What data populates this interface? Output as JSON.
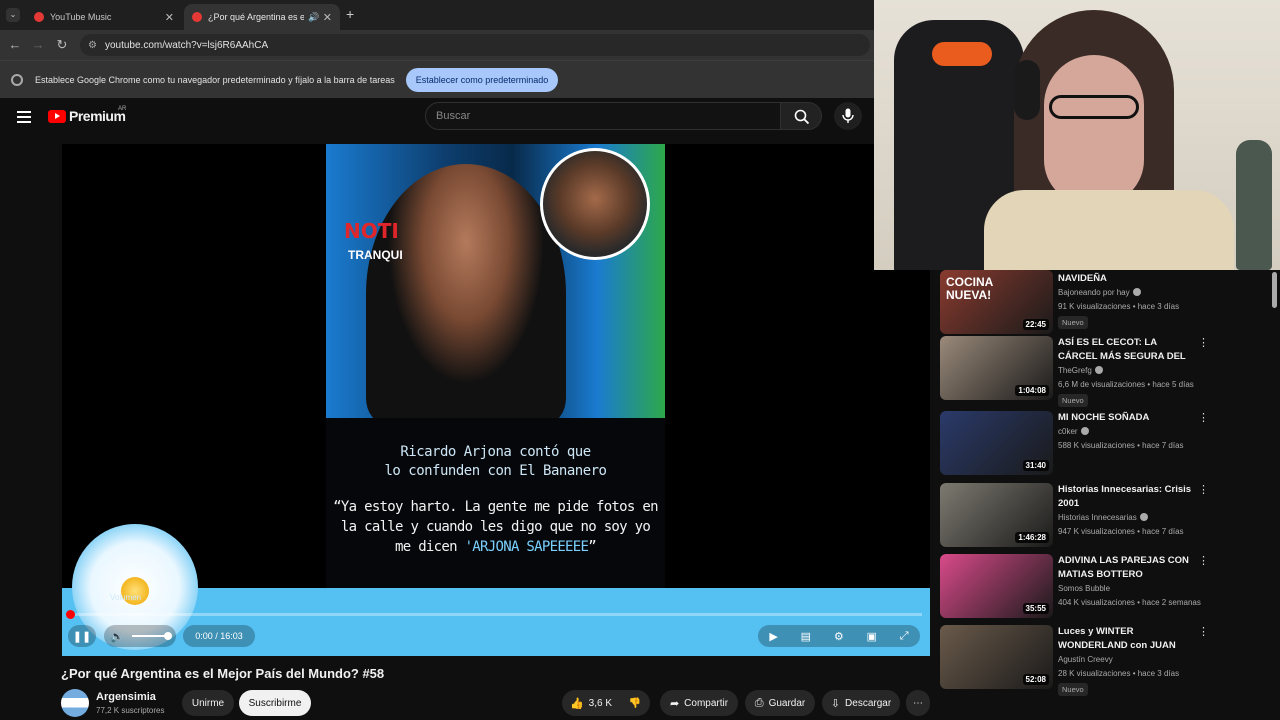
{
  "browser": {
    "tabs": [
      {
        "title": "YouTube Music",
        "active": false
      },
      {
        "title": "¿Por qué Argentina es el M",
        "active": true
      }
    ],
    "new_tab": "+",
    "url": "youtube.com/watch?v=lsj6R6AAhCA",
    "infobar": {
      "message": "Establece Google Chrome como tu navegador predeterminado y fíjalo a la barra de tareas",
      "button": "Establecer como predeterminado"
    }
  },
  "youtube": {
    "logo_text": "Premium",
    "country_code": "AR",
    "search_placeholder": "Buscar"
  },
  "video": {
    "overlay": {
      "show_name_1": "NOTI",
      "show_name_2": "TRANQUI",
      "caption_line1": "Ricardo Arjona contó que",
      "caption_line2": "lo confunden con El Bananero",
      "quote_line1": "“Ya estoy harto. La gente me pide fotos en",
      "quote_line2": "la calle y cuando les digo que no soy yo",
      "quote_line3_prefix": "me dicen ",
      "quote_line3_highlight": "'ARJONA SAPEEEEE",
      "quote_line3_suffix": "”"
    },
    "volume_tooltip": "Volumen",
    "time": "0:00 / 16:03",
    "progress": 0.0,
    "title": "¿Por qué Argentina es el Mejor País del Mundo? #58"
  },
  "channel": {
    "name": "Argensimia",
    "subscribers": "77,2 K suscriptores",
    "join": "Unirme",
    "subscribe": "Suscribirme"
  },
  "actions": {
    "likes": "3,6 K",
    "share": "Compartir",
    "save": "Guardar",
    "download": "Descargar"
  },
  "recommendations": [
    {
      "title": "NAVIDEÑA",
      "thumb_text": "COCINA NUEVA!",
      "channel": "Bajoneando por hay",
      "verified": true,
      "meta": "91 K visualizaciones • hace 3 días",
      "duration": "22:45",
      "badge": "Nuevo",
      "thumb_color": "#8a3b2f"
    },
    {
      "title": "ASÍ ES EL CECOT: LA CÁRCEL MÁS SEGURA DEL MUNDO",
      "channel": "TheGrefg",
      "verified": true,
      "meta": "6,6 M de visualizaciones • hace 5 días",
      "duration": "1:04:08",
      "badge": "Nuevo",
      "thumb_color": "#9a8a7a"
    },
    {
      "title": "MI NOCHE SOÑADA",
      "channel": "c0ker",
      "verified": true,
      "meta": "588 K visualizaciones • hace 7 días",
      "duration": "31:40",
      "badge": "",
      "thumb_color": "#2a3a6a"
    },
    {
      "title": "Historias Innecesarias: Crisis 2001",
      "channel": "Historias Innecesarias",
      "verified": true,
      "meta": "947 K visualizaciones • hace 7 días",
      "duration": "1:46:28",
      "badge": "",
      "thumb_color": "#7d7a70"
    },
    {
      "title": "ADIVINA LAS PAREJAS CON MATIAS BOTTERO",
      "channel": "Somos Bubble",
      "verified": false,
      "meta": "404 K visualizaciones • hace 2 semanas",
      "duration": "35:55",
      "badge": "",
      "thumb_color": "#d94a8a"
    },
    {
      "title": "Luces y WINTER WONDERLAND con JUAN GONZÁLEZ y LUCIO...",
      "channel": "Agustín Creevy",
      "verified": false,
      "meta": "28 K visualizaciones • hace 3 días",
      "duration": "52:08",
      "badge": "Nuevo",
      "thumb_color": "#6a5a4a"
    }
  ]
}
